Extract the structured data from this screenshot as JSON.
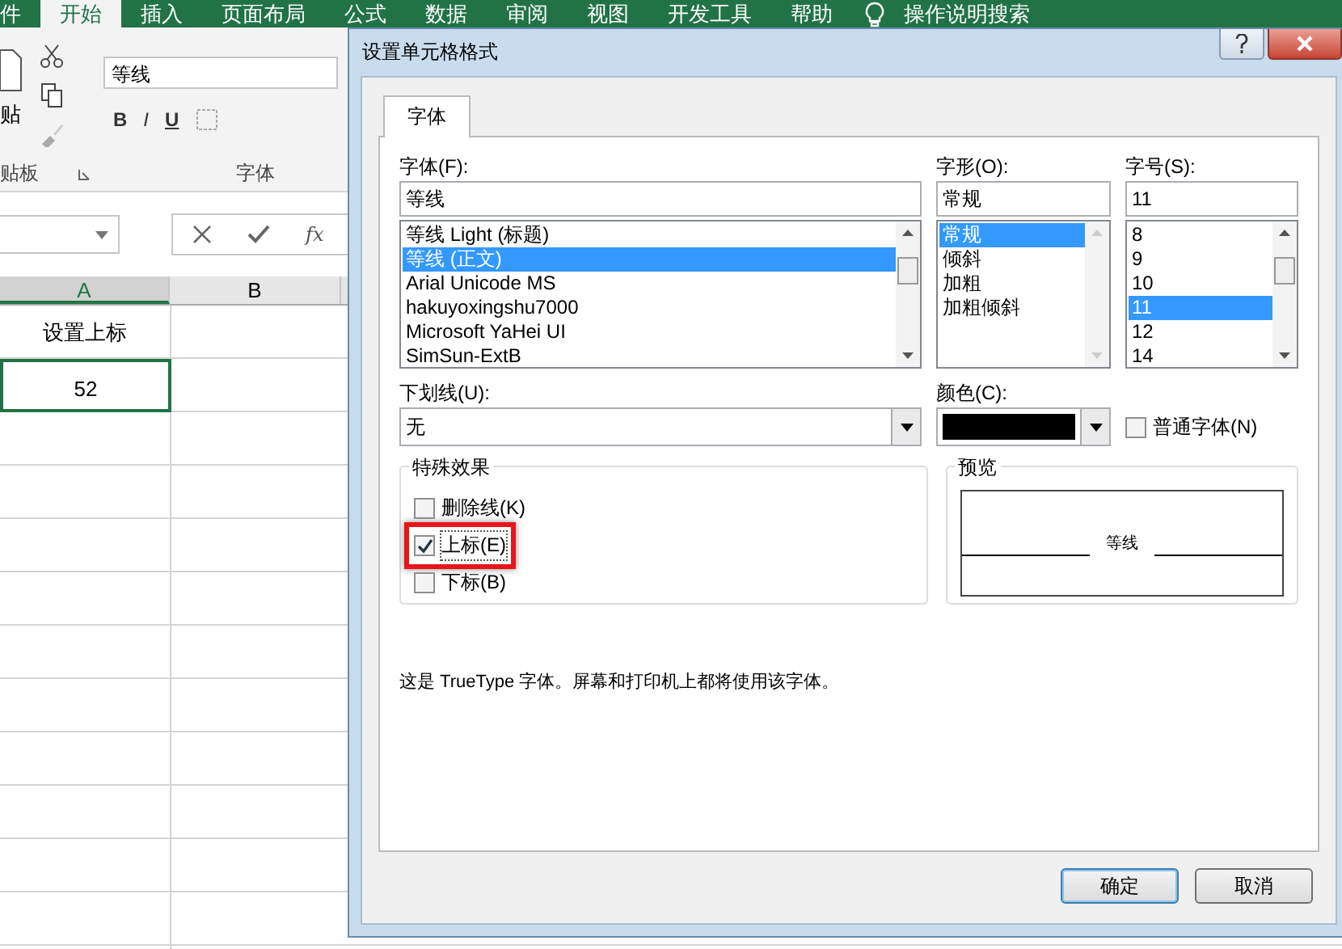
{
  "ribbon_tabs": [
    {
      "label": "件",
      "selected": false
    },
    {
      "label": "开始",
      "selected": true
    },
    {
      "label": "插入",
      "selected": false
    },
    {
      "label": "页面布局",
      "selected": false
    },
    {
      "label": "公式",
      "selected": false
    },
    {
      "label": "数据",
      "selected": false
    },
    {
      "label": "审阅",
      "selected": false
    },
    {
      "label": "视图",
      "selected": false
    },
    {
      "label": "开发工具",
      "selected": false
    },
    {
      "label": "帮助",
      "selected": false
    }
  ],
  "tell_me": "操作说明搜索",
  "ribbon": {
    "paste_label": "贴",
    "font_name": "等线",
    "bold": "B",
    "italic": "I",
    "underline": "U",
    "group_labels": [
      "贴板",
      "字体"
    ]
  },
  "formula_bar": {
    "function_label": "fx"
  },
  "sheet": {
    "columns": [
      "A",
      "B"
    ],
    "cells": [
      {
        "text": "设置上标",
        "selected": false
      },
      {
        "text": "52",
        "selected": true
      }
    ]
  },
  "dialog": {
    "title": "设置单元格格式",
    "tabs": [
      {
        "label": "字体",
        "selected": true
      }
    ],
    "font": {
      "label": "字体(F):",
      "value": "等线",
      "items": [
        {
          "label": "等线 Light (标题)",
          "selected": false
        },
        {
          "label": "等线 (正文)",
          "selected": true
        },
        {
          "label": "Arial Unicode MS",
          "selected": false
        },
        {
          "label": "hakuyoxingshu7000",
          "selected": false
        },
        {
          "label": "Microsoft YaHei UI",
          "selected": false
        },
        {
          "label": "SimSun-ExtB",
          "selected": false
        }
      ]
    },
    "style": {
      "label": "字形(O):",
      "value": "常规",
      "items": [
        {
          "label": "常规",
          "selected": true
        },
        {
          "label": "倾斜",
          "selected": false
        },
        {
          "label": "加粗",
          "selected": false
        },
        {
          "label": "加粗倾斜",
          "selected": false
        }
      ]
    },
    "size": {
      "label": "字号(S):",
      "value": "11",
      "items": [
        {
          "label": "8",
          "selected": false
        },
        {
          "label": "9",
          "selected": false
        },
        {
          "label": "10",
          "selected": false
        },
        {
          "label": "11",
          "selected": true
        },
        {
          "label": "12",
          "selected": false
        },
        {
          "label": "14",
          "selected": false
        }
      ]
    },
    "underline": {
      "label": "下划线(U):",
      "value": "无"
    },
    "color": {
      "label": "颜色(C):"
    },
    "normal_font": {
      "label": "普通字体(N)",
      "checked": false
    },
    "effects": {
      "title": "特殊效果",
      "items": [
        {
          "label": "删除线(K)",
          "checked": false,
          "highlighted": false
        },
        {
          "label": "上标(E)",
          "checked": true,
          "highlighted": true
        },
        {
          "label": "下标(B)",
          "checked": false,
          "highlighted": false
        }
      ]
    },
    "preview": {
      "title": "预览",
      "sample": "等线"
    },
    "info": "这是 TrueType 字体。屏幕和打印机上都将使用该字体。",
    "buttons": [
      {
        "label": "确定",
        "default": true
      },
      {
        "label": "取消",
        "default": false
      }
    ]
  }
}
